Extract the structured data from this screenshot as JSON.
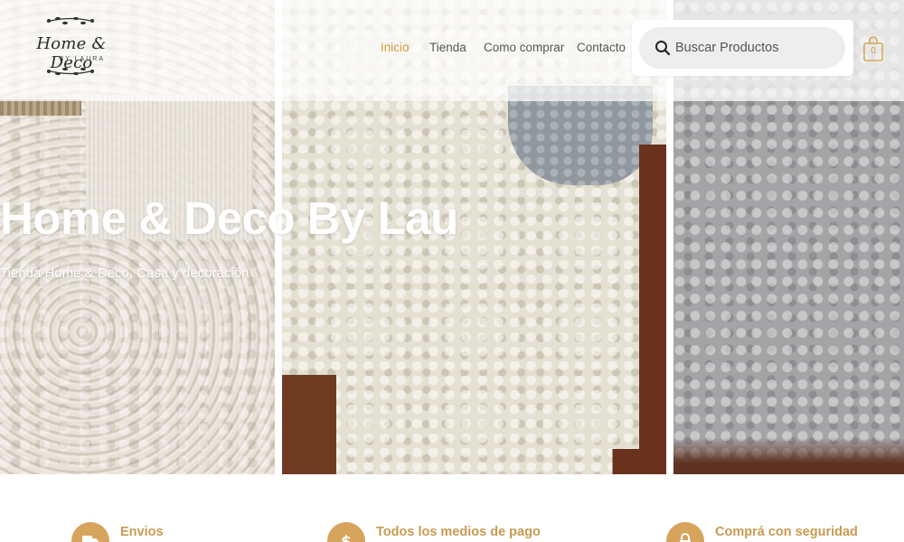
{
  "site": {
    "logo_title": "Home & Deco",
    "logo_subtitle": "BY LAURA"
  },
  "nav": {
    "items": [
      {
        "label": "Inicio",
        "active": true
      },
      {
        "label": "Tienda",
        "active": false
      },
      {
        "label": "Como comprar",
        "active": false
      },
      {
        "label": "Contacto",
        "active": false
      }
    ]
  },
  "search": {
    "placeholder": "Buscar Productos",
    "value": ""
  },
  "cart": {
    "count": "0"
  },
  "hero": {
    "title": "Home & Deco By Lau",
    "subtitle": "Tienda Home & Deco, Casa y decoración ♡"
  },
  "features": [
    {
      "label": "Envios",
      "icon": "truck-icon"
    },
    {
      "label": "Todos los medios de pago",
      "icon": "dollar-icon"
    },
    {
      "label": "Comprá con seguridad",
      "icon": "lock-icon"
    }
  ],
  "colors": {
    "accent": "#d39a3b",
    "feature_circle": "#d6a45c",
    "feature_text": "#c99a52"
  }
}
